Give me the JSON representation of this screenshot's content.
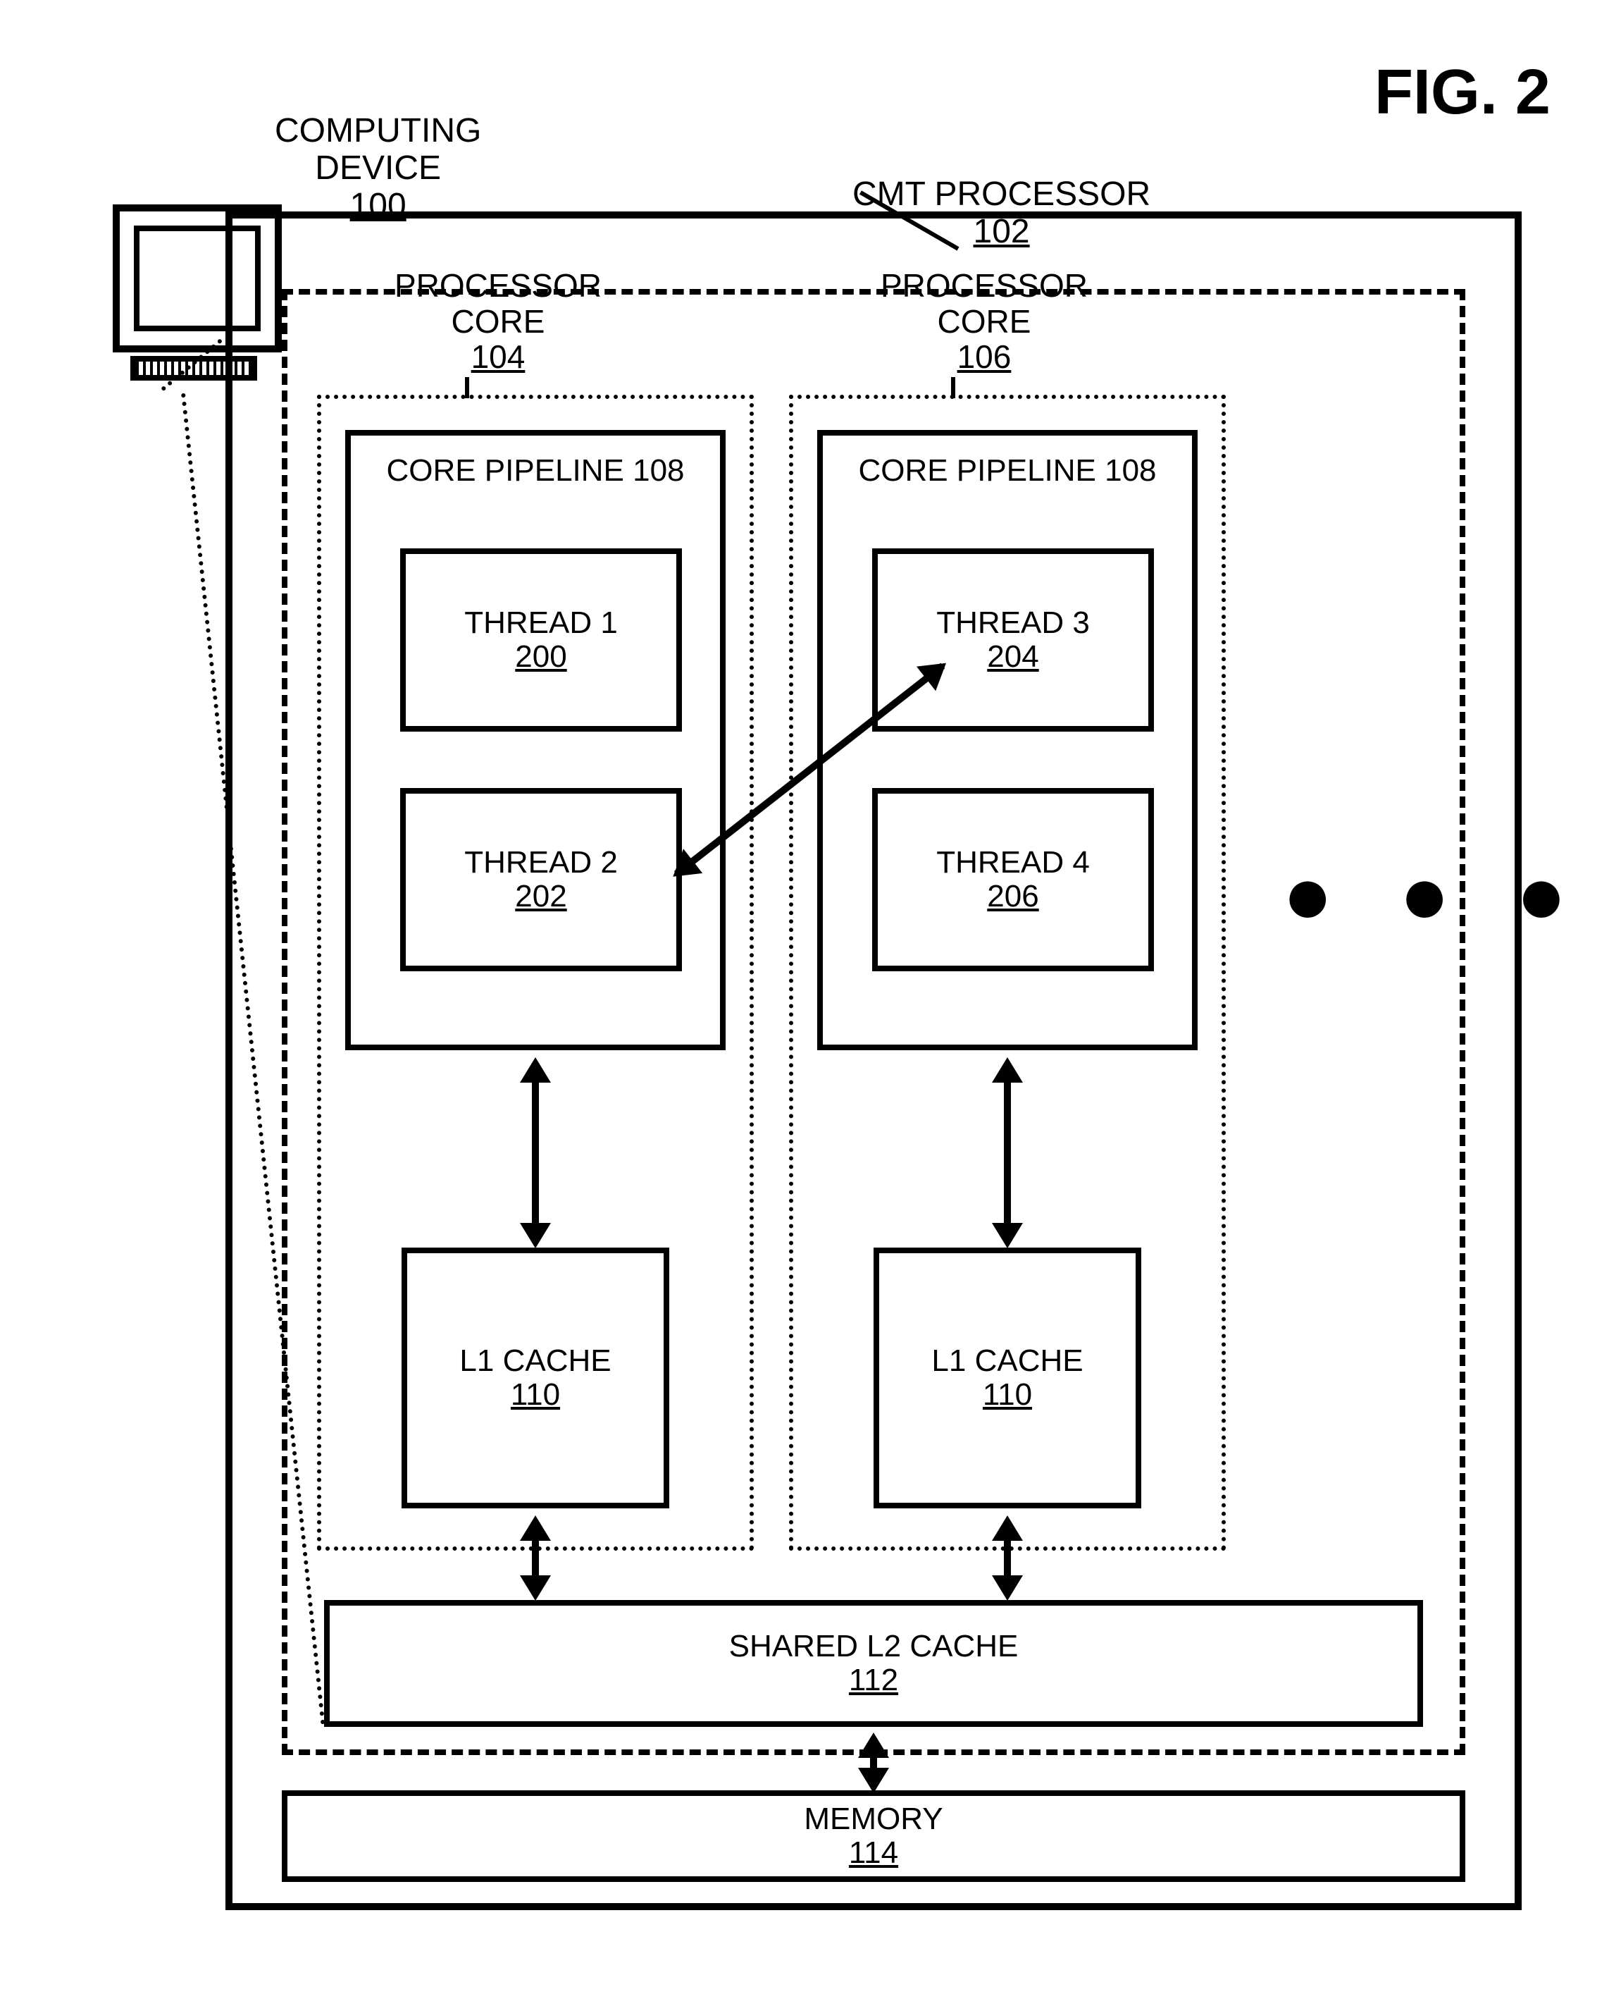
{
  "figure_title": "FIG. 2",
  "computing_device": {
    "label": "COMPUTING",
    "sub": "DEVICE",
    "ref": "100"
  },
  "cmt": {
    "label": "CMT PROCESSOR",
    "ref": "102"
  },
  "core1": {
    "label": "PROCESSOR",
    "sub": "CORE",
    "ref": "104"
  },
  "core2": {
    "label": "PROCESSOR",
    "sub": "CORE",
    "ref": "106"
  },
  "pipeline_label": "CORE PIPELINE 108",
  "threads": {
    "t1": {
      "label": "THREAD 1",
      "ref": "200"
    },
    "t2": {
      "label": "THREAD 2",
      "ref": "202"
    },
    "t3": {
      "label": "THREAD 3",
      "ref": "204"
    },
    "t4": {
      "label": "THREAD 4",
      "ref": "206"
    }
  },
  "l1": {
    "label": "L1 CACHE",
    "ref": "110"
  },
  "l2": {
    "label": "SHARED L2 CACHE",
    "ref": "112"
  },
  "memory": {
    "label": "MEMORY",
    "ref": "114"
  },
  "ellipsis": "● ● ●"
}
